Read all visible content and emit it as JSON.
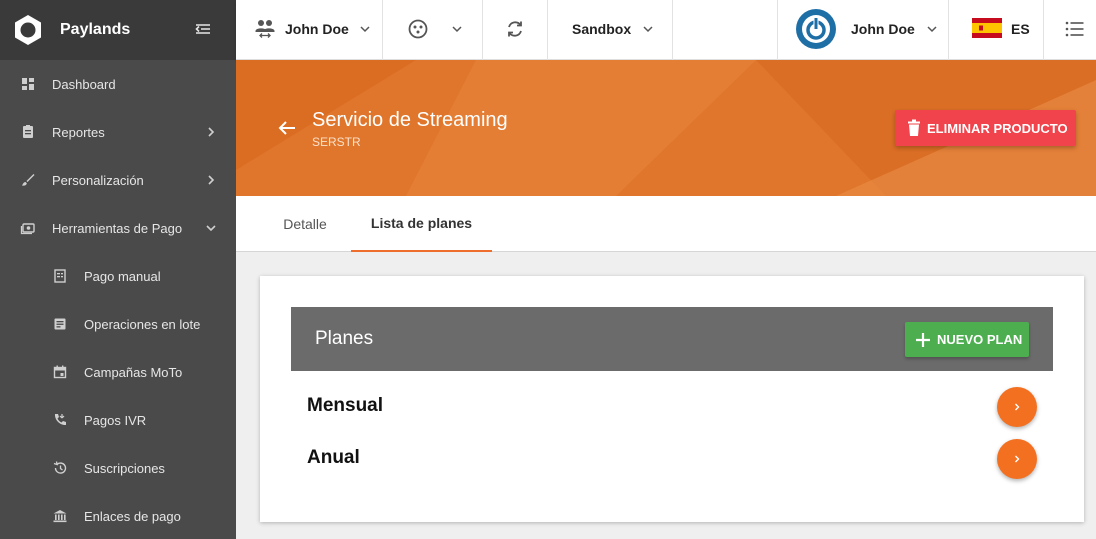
{
  "app": {
    "name": "Paylands"
  },
  "sidebar": {
    "items": [
      {
        "label": "Dashboard",
        "icon": "dashboard-icon",
        "has_arrow": false
      },
      {
        "label": "Reportes",
        "icon": "report-icon",
        "has_arrow": true
      },
      {
        "label": "Personalización",
        "icon": "brush-icon",
        "has_arrow": true
      },
      {
        "label": "Herramientas de Pago",
        "icon": "payment-tools-icon",
        "expanded": true
      }
    ],
    "subitems": [
      {
        "label": "Pago manual",
        "icon": "receipt-icon"
      },
      {
        "label": "Operaciones en lote",
        "icon": "batch-icon"
      },
      {
        "label": "Campañas MoTo",
        "icon": "calendar-icon"
      },
      {
        "label": "Pagos IVR",
        "icon": "phone-icon"
      },
      {
        "label": "Suscripciones",
        "icon": "history-icon"
      },
      {
        "label": "Enlaces de pago",
        "icon": "bank-icon"
      }
    ]
  },
  "topbar": {
    "account_name": "John Doe",
    "environment": "Sandbox",
    "user_name": "John Doe",
    "language": "ES"
  },
  "product": {
    "title": "Servicio de Streaming",
    "code": "SERSTR",
    "delete_label": "ELIMINAR PRODUCTO"
  },
  "tabs": [
    {
      "label": "Detalle",
      "active": false
    },
    {
      "label": "Lista de planes",
      "active": true
    }
  ],
  "plans_card": {
    "title": "Planes",
    "add_label": "NUEVO PLAN",
    "plans": [
      "Mensual",
      "Anual"
    ]
  },
  "colors": {
    "accent": "#f37021",
    "hero": "#e0762b",
    "danger": "#f0434b",
    "success": "#4cae4f",
    "sidebar": "#4a4a4a"
  }
}
